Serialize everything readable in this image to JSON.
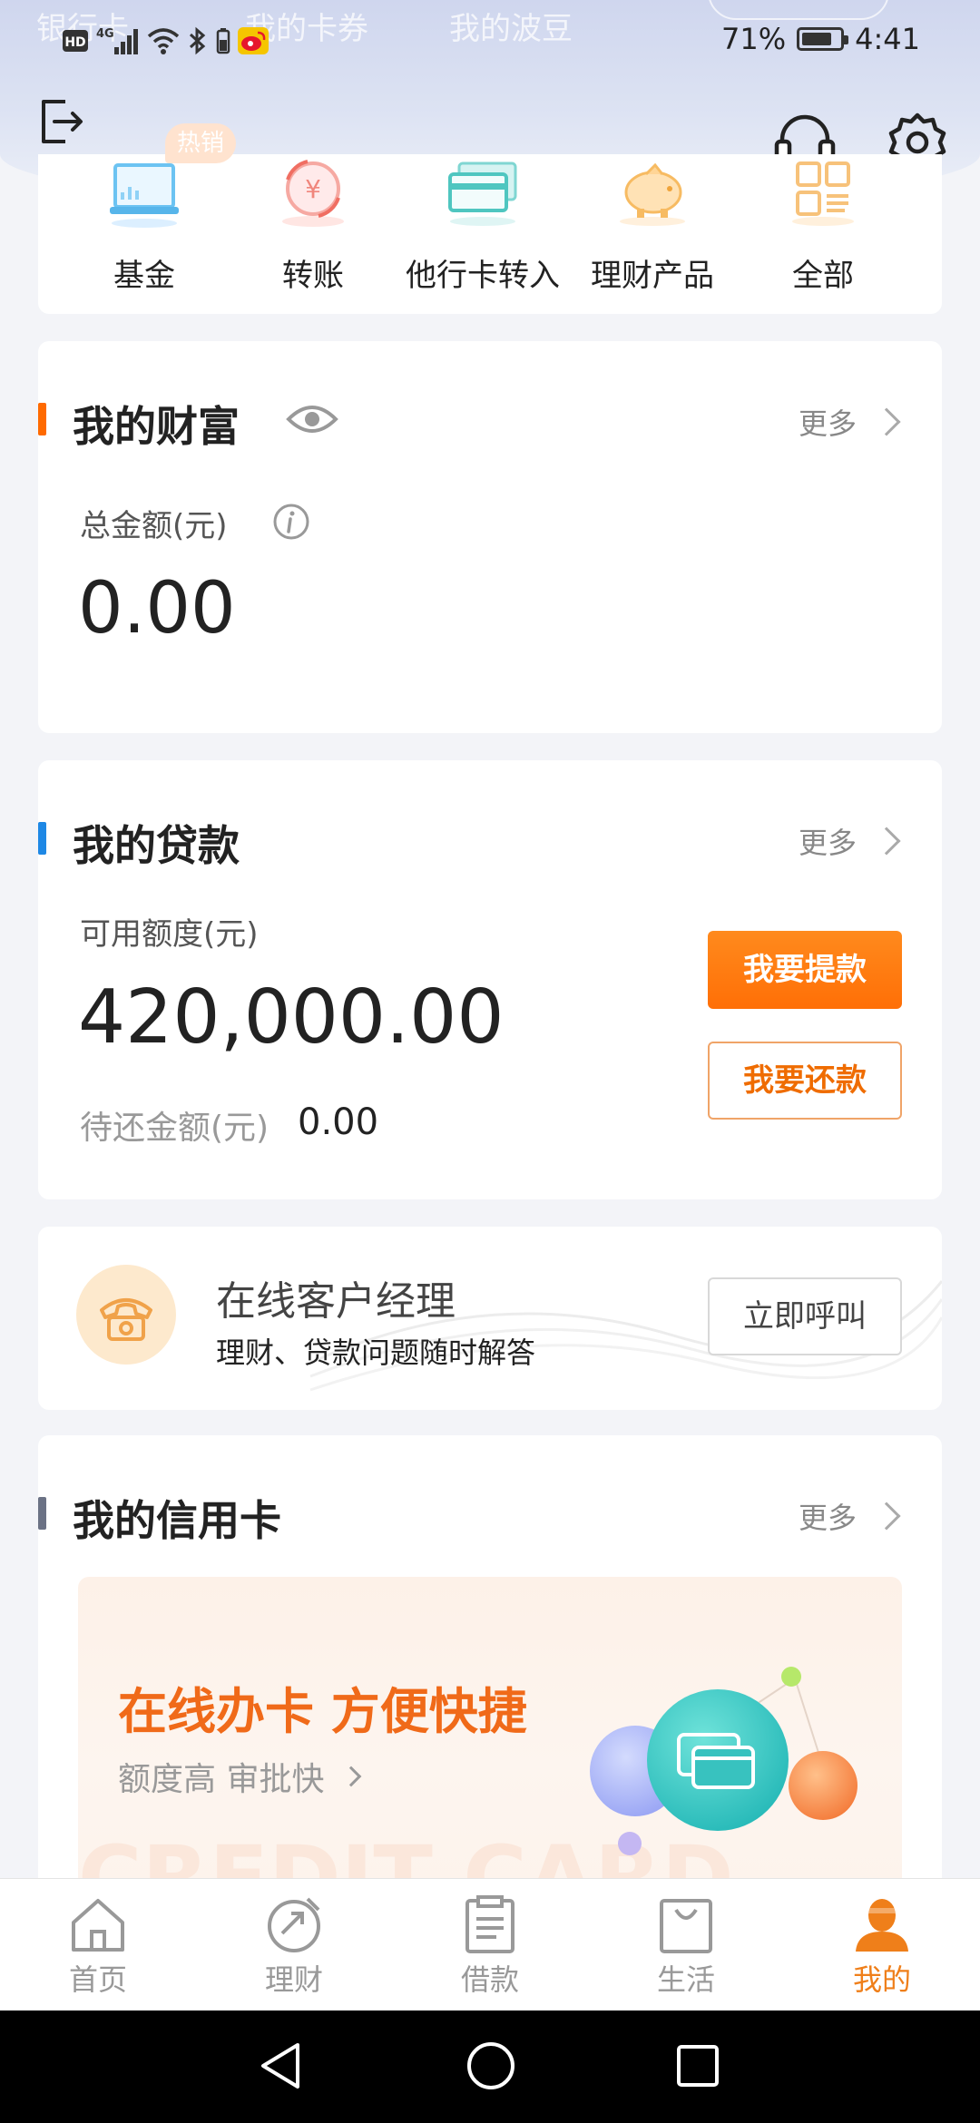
{
  "header_bg_tabs": [
    "银行卡",
    "我的卡券",
    "我的波豆"
  ],
  "status_bar": {
    "battery": "71%",
    "time": "4:41",
    "network_badge": "HD",
    "network_type": "4G"
  },
  "header_icons": [
    "logout-icon",
    "headset-icon",
    "gear-icon"
  ],
  "quick_actions": {
    "hot_badge": "热销",
    "items": [
      {
        "label": "基金",
        "icon": "fund-icon"
      },
      {
        "label": "转账",
        "icon": "transfer-icon"
      },
      {
        "label": "他行卡转入",
        "icon": "card-transfer-icon"
      },
      {
        "label": "理财产品",
        "icon": "piggy-bank-icon"
      },
      {
        "label": "全部",
        "icon": "grid-icon"
      }
    ]
  },
  "wealth": {
    "title": "我的财富",
    "more": "更多",
    "total_label": "总金额(元)",
    "total_value": "0.00",
    "accent": "#ff6a00"
  },
  "loan": {
    "title": "我的贷款",
    "more": "更多",
    "available_label": "可用额度(元)",
    "available_value": "420,000.00",
    "pending_label": "待还金额(元)",
    "pending_value": "0.00",
    "withdraw_button": "我要提款",
    "repay_button": "我要还款",
    "accent": "#1e88e5"
  },
  "manager": {
    "title": "在线客户经理",
    "subtitle": "理财、贷款问题随时解答",
    "call_button": "立即呼叫"
  },
  "credit": {
    "title": "我的信用卡",
    "more": "更多",
    "promo_title": "在线办卡 方便快捷",
    "promo_subtitle": "额度高 审批快",
    "watermark": "CREDIT CARD",
    "accent": "#6b7285"
  },
  "tab_bar": {
    "items": [
      {
        "label": "首页",
        "icon": "home-icon"
      },
      {
        "label": "理财",
        "icon": "wealth-icon"
      },
      {
        "label": "借款",
        "icon": "loan-icon"
      },
      {
        "label": "生活",
        "icon": "shopping-bag-icon"
      },
      {
        "label": "我的",
        "icon": "profile-icon"
      }
    ],
    "active": "我的"
  },
  "colors": {
    "brand_orange": "#ff6f06",
    "active_tab": "#ef7f1a",
    "page_bg": "#f3f4f8"
  }
}
